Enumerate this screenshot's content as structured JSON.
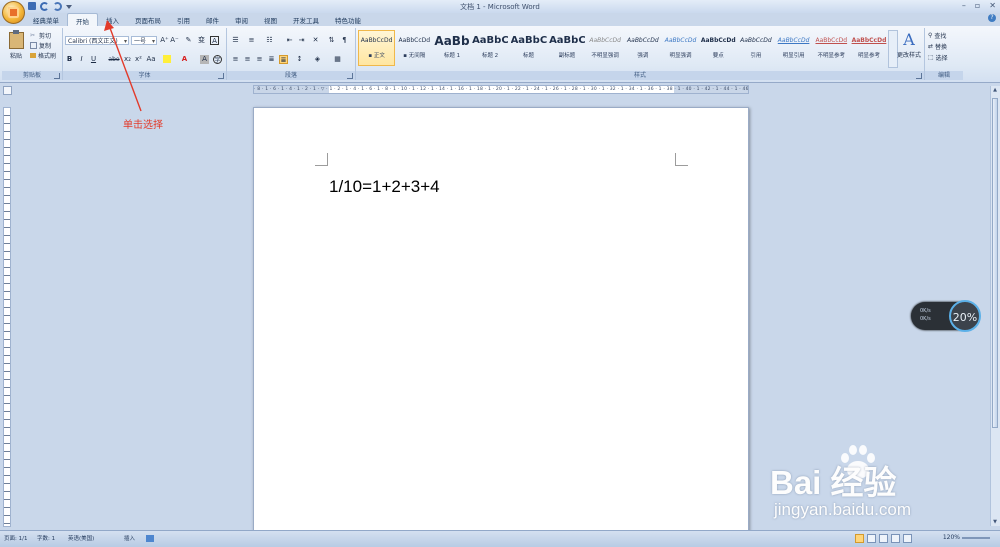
{
  "window": {
    "title": "文档 1 - Microsoft Word",
    "controls": [
      "–",
      "▫",
      "✕"
    ]
  },
  "tabs": [
    "经典菜单",
    "开始",
    "插入",
    "页面布局",
    "引用",
    "邮件",
    "审阅",
    "视图",
    "开发工具",
    "特色功能"
  ],
  "active_tab": "开始",
  "clipboard": {
    "paste": "粘贴",
    "cut": "剪切",
    "copy": "复制",
    "format_painter": "格式刷",
    "group_label": "剪贴板"
  },
  "font": {
    "font_name": "Calibri (西文正文)",
    "font_size": "一号",
    "grow": "A⁺",
    "shrink": "A⁻",
    "bold": "B",
    "italic": "I",
    "underline": "U",
    "strike": "abe",
    "subscript": "x₂",
    "superscript": "x²",
    "change_case": "Aa",
    "group_label": "字体"
  },
  "paragraph": {
    "group_label": "段落"
  },
  "styles": {
    "items": [
      {
        "sample": "AaBbCcDd",
        "name": "▪ 正文"
      },
      {
        "sample": "AaBbCcDd",
        "name": "▪ 无间隔"
      },
      {
        "sample": "AaBb",
        "name": "标题 1"
      },
      {
        "sample": "AaBbC",
        "name": "标题 2"
      },
      {
        "sample": "AaBbC",
        "name": "标题"
      },
      {
        "sample": "AaBbC",
        "name": "副标题"
      },
      {
        "sample": "AaBbCcDd",
        "name": "不明显强调"
      },
      {
        "sample": "AaBbCcDd",
        "name": "强调"
      },
      {
        "sample": "AaBbCcDd",
        "name": "明显强调"
      },
      {
        "sample": "AaBbCcDd",
        "name": "要点"
      },
      {
        "sample": "AaBbCcDd",
        "name": "引用"
      },
      {
        "sample": "AaBbCcDd",
        "name": "明显引用"
      },
      {
        "sample": "AaBbCcDd",
        "name": "不明显参考"
      },
      {
        "sample": "AaBbCcDd",
        "name": "明显参考"
      }
    ],
    "selected_index": 0,
    "change_styles": "更改样式",
    "group_label": "样式"
  },
  "editing": {
    "find": "查找",
    "replace": "替换",
    "select": "选择",
    "group_label": "编辑"
  },
  "ruler": {
    "ticks": "· 8 · 1 · 6 · 1 · 4 · 1 · 2 · 1 · ▽ · 1 · 2 · 1 · 4 · 1 · 6 · 1 · 8 · 1 · 10 · 1 · 12 · 1 · 14 · 1 · 16 · 1 · 18 · 1 · 20 · 1 · 22 · 1 · 24 · 1 · 26 · 1 · 28 · 1 · 30 · 1 · 32 · 1 · 34 · 1 · 36 · 1 · 38 · 1 · 40 · 1 · 42 · 1 · 44 · 1 · 46 · 1 · 48"
  },
  "document": {
    "content": "1/10=1+2+3+4"
  },
  "annotation": {
    "text": "单击选择",
    "color": "#e23a2a"
  },
  "floating_widget": {
    "line1": "0K/s",
    "line2": "0K/s",
    "percent": "20%"
  },
  "status": {
    "page": "页面: 1/1",
    "words": "字数: 1",
    "language": "英语(美国)",
    "mode": "插入",
    "zoom": "120%"
  },
  "watermark": {
    "brand": "Bai  经验",
    "url": "jingyan.baidu.com"
  }
}
